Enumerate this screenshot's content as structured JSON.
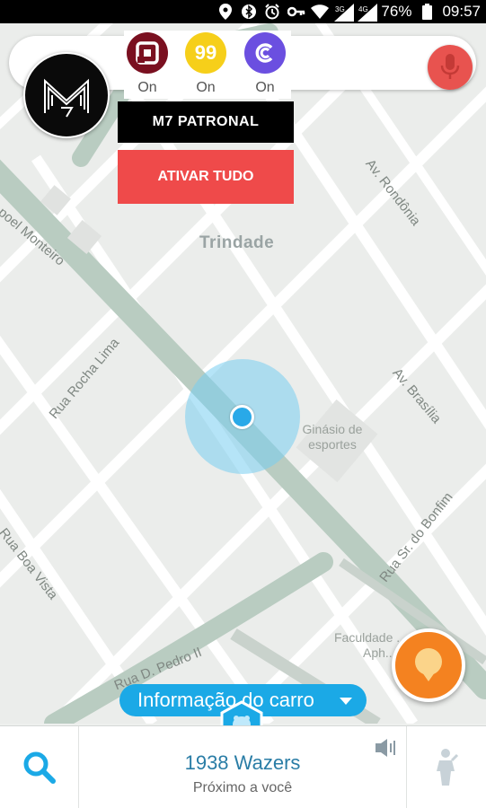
{
  "status_bar": {
    "battery": "76%",
    "time": "09:57",
    "icons": [
      "location-icon",
      "bluetooth-icon",
      "alarm-icon",
      "key-icon",
      "wifi-icon",
      "signal-3g-icon",
      "signal-4g-icon",
      "battery-icon"
    ]
  },
  "map": {
    "district": "Trindade",
    "streets": [
      {
        "name": "Av. Rondônia"
      },
      {
        "name": "poel Monteiro"
      },
      {
        "name": "Rua Rocha Lima"
      },
      {
        "name": "Av. Brasília"
      },
      {
        "name": "Rua Sr. do Bonfim"
      },
      {
        "name": "Rua Boa Vista"
      },
      {
        "name": "Rua D. Pedro II"
      }
    ],
    "places": [
      {
        "line1": "Ginásio de",
        "line2": "esportes"
      },
      {
        "line1": "Faculdade ... io",
        "line2": "Aph..."
      }
    ]
  },
  "overlay": {
    "logo_text": "M7",
    "toggles": [
      {
        "service": "pop-app",
        "label": "On",
        "color": "#7a1020"
      },
      {
        "service": "99-app",
        "label": "On",
        "color": "#f6cf1a",
        "text": "99"
      },
      {
        "service": "cabify-app",
        "label": "On",
        "color": "#6b4fe0"
      }
    ],
    "patronal_label": "M7 PATRONAL",
    "ativar_label": "ATIVAR TUDO"
  },
  "car_info": {
    "label": "Informação do carro"
  },
  "bottom_bar": {
    "wazers": "1938 Wazers",
    "nearby": "Próximo a você"
  },
  "colors": {
    "accent_blue": "#1ba9e6",
    "mic_red": "#e8534f",
    "ativar_red": "#ef4a4a",
    "report_orange": "#f48220"
  }
}
